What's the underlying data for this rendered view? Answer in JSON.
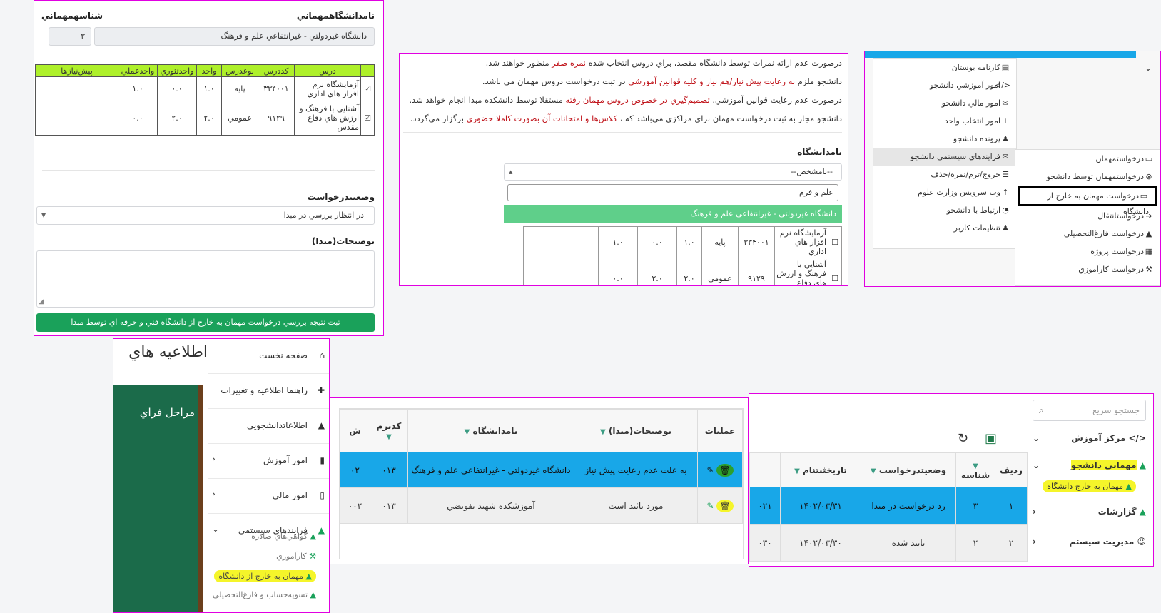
{
  "guest_form": {
    "university_label": "نامدانشگاهمهماني",
    "guest_id_label": "شناسهمهماني",
    "university_value": "دانشگاه غيردولتي - غيرانتفاعي علم و فرهنگ",
    "guest_id_value": "۳",
    "table_headers": [
      "",
      "درس",
      "كددرس",
      "نوعدرس",
      "واحد",
      "واحدتئوري",
      "واحدعملي",
      "پيش‌نيازها"
    ],
    "rows": [
      {
        "check": "☑",
        "course": "آزمايشگاه نرم افزار هاي اداري",
        "code": "۳۳۴۰۰۱",
        "type": "پايه",
        "units": "۱.۰",
        "theory": "۰.۰",
        "practical": "۱.۰",
        "prereq": ""
      },
      {
        "check": "☑",
        "course": "آشنايي با فرهنگ و ارزش هاي دفاع مقدس",
        "code": "۹۱۲۹",
        "type": "عمومي",
        "units": "۲.۰",
        "theory": "۲.۰",
        "practical": "۰.۰",
        "prereq": ""
      }
    ],
    "status_label": "وضعيتدرخواست",
    "status_value": "در انتظار بررسي در مبدا",
    "notes_label": "توضيحات(مبدا)",
    "submit_label": "ثبت نتيجه بررسي درخواست مهمان به خارج از دانشگاه فني و حرفه اي توسط مبدا"
  },
  "rules": {
    "p1_a": "درصورت عدم ارائه نمرات توسط دانشگاه مقصد، براي دروس انتخاب شده",
    "p1_red": "نمره صفر",
    "p1_b": "منظور خواهند شد.",
    "p2_a": "دانشجو ملزم",
    "p2_red": "به رعايت پيش نياز/هم نياز و كليه قوانين آموزشي",
    "p2_b": "در ثبت درخواست دروس مهمان مي باشد.",
    "p3_a": "درصورت عدم رعايت قوانين آموزشي،",
    "p3_red": "تصميم‌گيري در خصوص دروس مهمان رفته",
    "p3_b": "مستقلا توسط دانشكده مبدا انجام خواهد شد.",
    "p4_a": "دانشجو مجاز به ثبت درخواست مهمان براي مراكزي مي‌باشد كه ،",
    "p4_red": "كلاس‌ها و امتحانات آن بصورت كاملا حضوري",
    "p4_b": "برگزار مي‌گردد.",
    "university_label": "نامدانشگاه",
    "select_value": "--نامشخص--",
    "search_value": "علم و فرم",
    "option_highlight": "دانشگاه غيردولتي - غيرانتفاعي علم و فرهنگ",
    "rows": [
      {
        "course": "آزمايشگاه نرم افزار هاي اداري",
        "code": "۳۳۴۰۰۱",
        "type": "پايه",
        "units": "۱.۰",
        "theory": "۰.۰",
        "practical": "۱.۰"
      },
      {
        "course": "آشنايي با فرهنگ و ارزش هاي دفاع مقدس",
        "code": "۹۱۲۹",
        "type": "عمومي",
        "units": "۲.۰",
        "theory": "۲.۰",
        "practical": "۰.۰"
      }
    ]
  },
  "menu": {
    "items": [
      "كارنامه بوستان",
      "امور آموزشي دانشجو",
      "امور مالي دانشجو",
      "امور انتخاب واحد",
      "پرونده دانشجو",
      "فرايندهاي سيستمي دانشجو",
      "خروج/ترم/نمره/حذف",
      "وب سرويس وزارت علوم",
      "ارتباط با دانشجو",
      "تنظيمات كاربر"
    ],
    "submenu": [
      "درخواستمهمان",
      "درخواستمهمان توسط دانشجو",
      "درخواست مهمان به خارج از دانشگاه",
      "درخواستانتقال",
      "درخواست فارغ‌التحصيلي",
      "درخواست پروژه",
      "درخواست كارآموزي"
    ]
  },
  "sidebar": {
    "items": [
      "صفحه نخست",
      "راهنما اطلاعيه و تغييرات",
      "اطلاعاتدانشجويي",
      "امور آموزش",
      "امور مالي",
      "فرايندهاي سيستمي"
    ],
    "subitems": [
      "گواهي‌هاي صادره",
      "كارآموزي",
      "مهمان به خارج از دانشگاه",
      "تسويه‌حساب و فارغ‌التحصيلي"
    ],
    "banner_title": "اطلاعيه هاي",
    "board_text": "مراحل فراي"
  },
  "requests_table": {
    "headers": {
      "ops": "عمليات",
      "notes": "توضيحات(مبدا)",
      "university": "نامدانشگاه",
      "term": "كدترم",
      "partial": "ش"
    },
    "rows": [
      {
        "notes": "به علت عدم رعايت پيش نياز",
        "university": "دانشگاه غيردولتي - غيرانتفاعي علم و فرهنگ",
        "term": "۰۱۳",
        "partial": "۰۲"
      },
      {
        "notes": "مورد تائيد است",
        "university": "آموزشكده شهيد تفويضي",
        "term": "۰۱۳",
        "partial": "۰۰۲"
      }
    ]
  },
  "guest_list": {
    "search_placeholder": "جستجو سريع",
    "nav": [
      "مركز آموزش",
      "مهماني دانشجو",
      "مهمان به خارج دانشگاه",
      "گزارشات",
      "مديريت سيستم"
    ],
    "headers": {
      "row": "رديف",
      "id": "شناسه",
      "status": "وضعيتدرخواست",
      "date": "تاريخثبتنام"
    },
    "rows": [
      {
        "row": "۱",
        "id": "۳",
        "status": "رد درخواست در مبدا",
        "date": "۱۴۰۲/۰۳/۳۱",
        "partial": "۰۲۱"
      },
      {
        "row": "۲",
        "id": "۲",
        "status": "تاييد شده",
        "date": "۱۴۰۲/۰۳/۳۰",
        "partial": "۰۳۰"
      }
    ]
  },
  "colors": {
    "panel_border": "#e100e1",
    "green_btn": "#1aa15a",
    "lime_header": "#aef02a",
    "selected_row": "#18a7e8",
    "highlight": "#f5f52a"
  }
}
